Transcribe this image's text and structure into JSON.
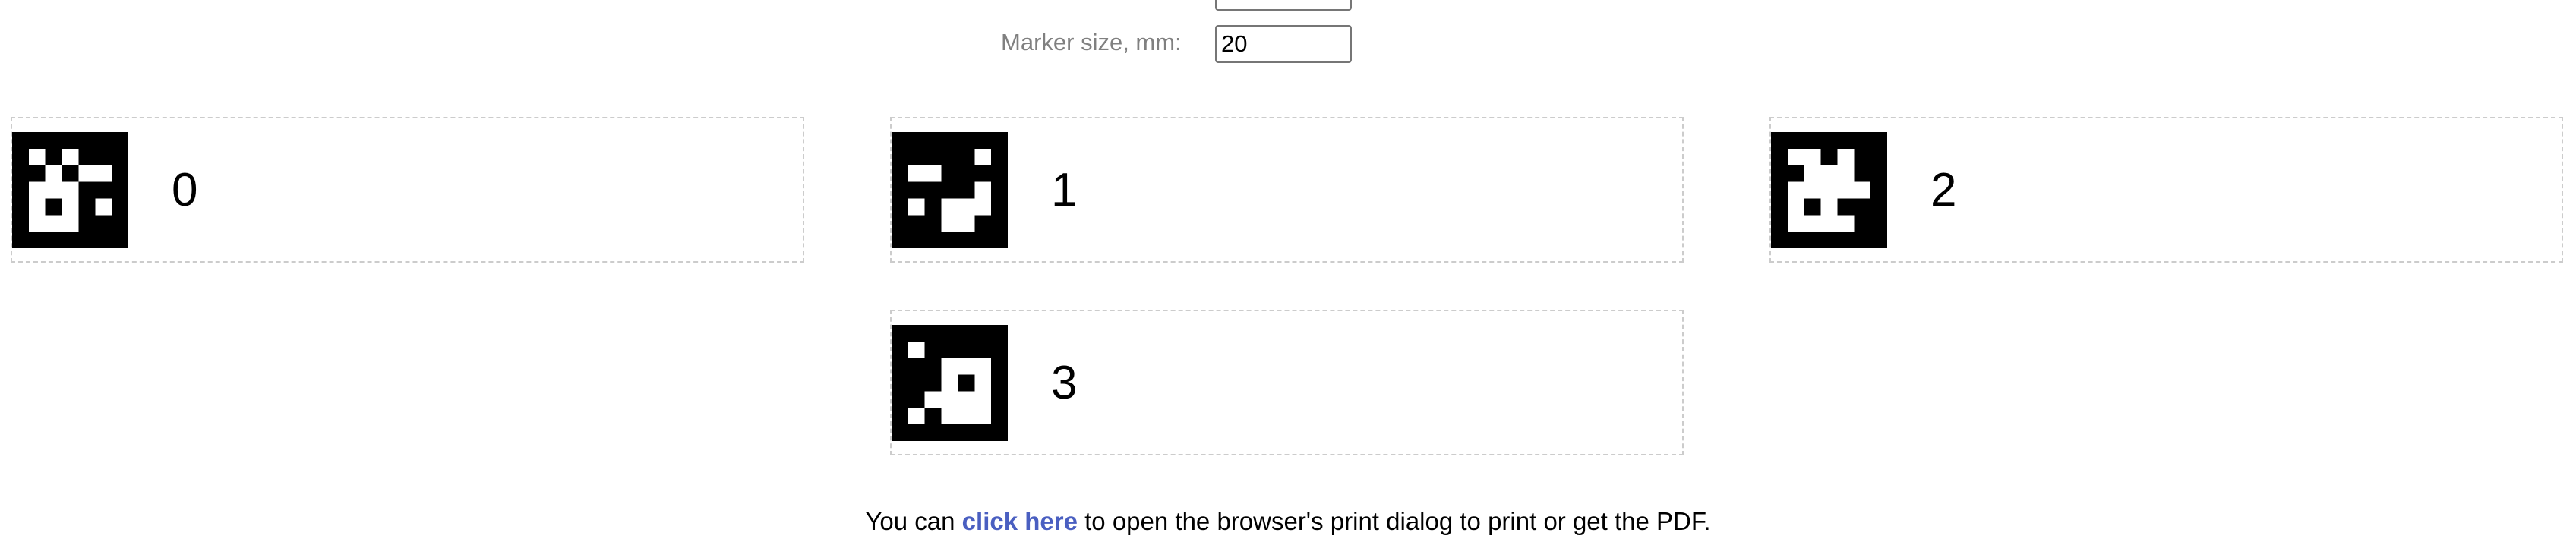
{
  "settings": {
    "marker_size_label": "Marker size, mm:",
    "marker_size_value": "20",
    "previous_field_value": ""
  },
  "markers": [
    {
      "id": "0"
    },
    {
      "id": "1"
    },
    {
      "id": "2"
    },
    {
      "id": "3"
    }
  ],
  "footer": {
    "prefix": "You can",
    "link": "click here",
    "suffix": "to open the browser's print dialog to print or get the PDF."
  },
  "colors": {
    "link": "#4a5fc1",
    "label": "#808080",
    "card_border": "#cccccc"
  }
}
